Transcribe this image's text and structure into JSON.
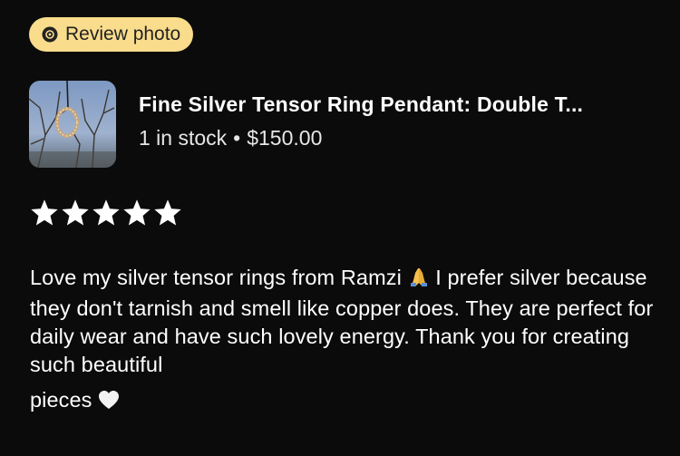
{
  "badge": {
    "label": "Review photo",
    "icon": "camera-icon",
    "color": "#f9dc8c"
  },
  "product": {
    "title": "Fine Silver Tensor Ring Pendant: Double T...",
    "stock": "1 in stock",
    "separator": "•",
    "price": "$150.00",
    "thumbnail": "pendant-photo"
  },
  "rating": {
    "stars": 5,
    "max": 5,
    "icon": "star-icon"
  },
  "review": {
    "text_part1": "Love my silver tensor rings from Ramzi",
    "text_part2": "I prefer silver because they don't tarnish and smell like copper does. They are perfect for daily wear and have such lovely energy. Thank you for creating such beautiful",
    "text_part3": "pieces",
    "emoji1": "folded-hands-emoji",
    "emoji2": "white-heart-emoji"
  }
}
